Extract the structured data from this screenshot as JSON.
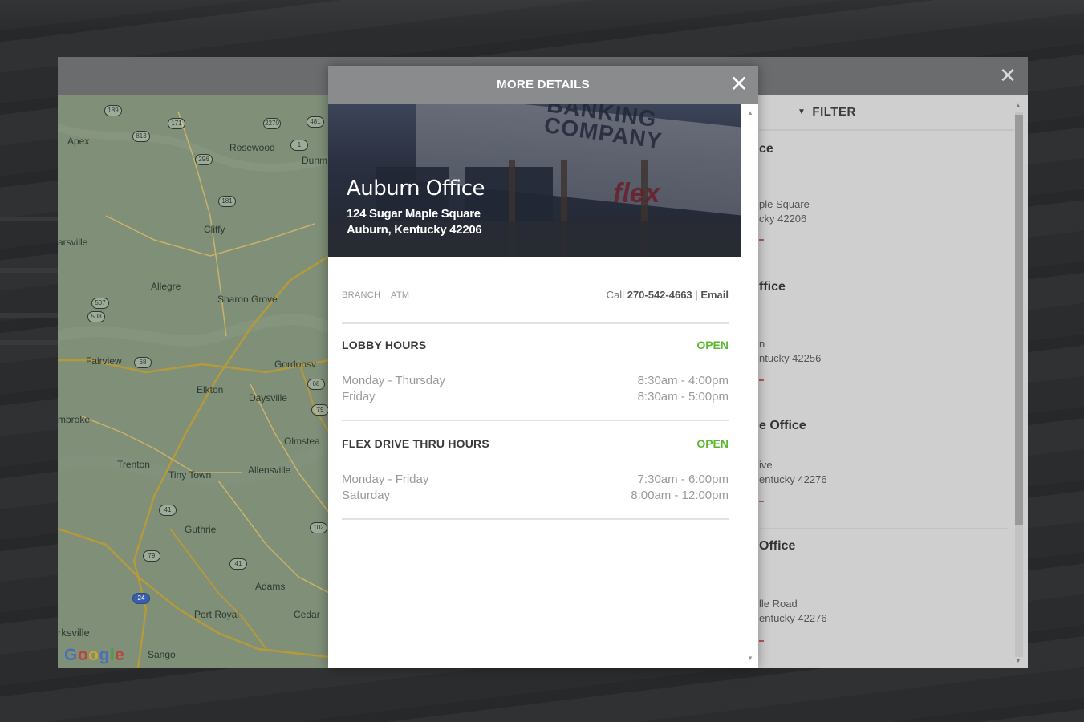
{
  "locator": {
    "close_icon": "close-icon",
    "filter_label": "FILTER",
    "list": [
      {
        "title": "ce",
        "line1": "ple Square",
        "line2": "cky 42206"
      },
      {
        "title": "ffice",
        "line1": "n",
        "line2": "ntucky 42256"
      },
      {
        "title": "e Office",
        "line1": "ive",
        "line2": "entucky 42276"
      },
      {
        "title": "Office",
        "line1": "lle Road",
        "line2": "entucky 42276"
      }
    ]
  },
  "map": {
    "places": [
      "Apex",
      "Rosewood",
      "Dunm",
      "Cliffy",
      "arsville",
      "Allegre",
      "Sharon Grove",
      "Fairview",
      "Gordonsv",
      "Elkton",
      "Daysville",
      "mbroke",
      "Olmstea",
      "Trenton",
      "Tiny Town",
      "Allensville",
      "Guthrie",
      "Adams",
      "Port Royal",
      "Cedar",
      "rksville",
      "Sango"
    ],
    "shields": [
      "189",
      "171",
      "2270",
      "481",
      "813",
      "1",
      "296",
      "181",
      "507",
      "508",
      "68",
      "68",
      "79",
      "41",
      "79",
      "41",
      "102",
      "24"
    ],
    "logo": "Google",
    "land_color": "#7f8f78",
    "road_color": "#b59a3c"
  },
  "details": {
    "title": "MORE DETAILS",
    "name": "Auburn Office",
    "address_line1": "124 Sugar Maple Square",
    "address_line2": "Auburn, Kentucky 42206",
    "photo_sign": "BANKING COMPANY",
    "photo_brand": "flex",
    "tags": [
      "BRANCH",
      "ATM"
    ],
    "contact_prefix": "Call",
    "phone": "270-542-4663",
    "contact_sep": "|",
    "email_label": "Email",
    "sections": [
      {
        "title": "LOBBY HOURS",
        "status": "OPEN",
        "rows": [
          {
            "day": "Monday - Thursday",
            "time": "8:30am - 4:00pm"
          },
          {
            "day": "Friday",
            "time": "8:30am - 5:00pm"
          }
        ]
      },
      {
        "title": "FLEX DRIVE THRU HOURS",
        "status": "OPEN",
        "rows": [
          {
            "day": "Monday - Friday",
            "time": "7:30am - 6:00pm"
          },
          {
            "day": "Saturday",
            "time": "8:00am - 12:00pm"
          }
        ]
      }
    ],
    "status_color": "#5cb82e"
  }
}
